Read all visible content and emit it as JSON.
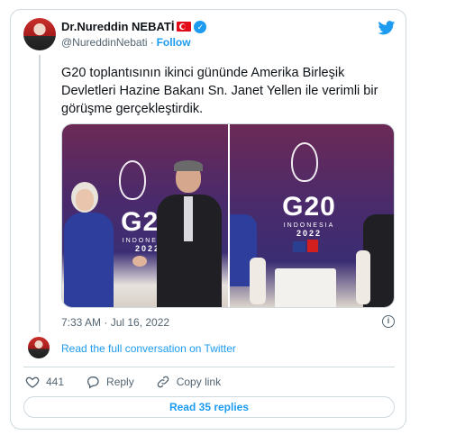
{
  "author": {
    "display_name": "Dr.Nureddin NEBATİ",
    "handle": "@NureddinNebati",
    "separator": "·",
    "follow_label": "Follow",
    "verified_mark": "✓"
  },
  "tweet": {
    "text": "G20 toplantısının ikinci gününde Amerika Birleşik Devletleri Hazine Bakanı Sn. Janet Yellen ile verimli bir görüşme gerçekleştirdik.",
    "timestamp": "7:33 AM · Jul 16, 2022",
    "info_glyph": "i"
  },
  "media": {
    "left_photo": {
      "logo_main": "G20",
      "logo_sub": "INDONESIA",
      "logo_year": "2022"
    },
    "right_photo": {
      "logo_main": "G20",
      "logo_sub": "INDONESIA",
      "logo_year": "2022"
    }
  },
  "conversation": {
    "link_label": "Read the full conversation on Twitter"
  },
  "actions": {
    "like_count": "441",
    "reply_label": "Reply",
    "copy_link_label": "Copy link"
  },
  "replies_button": {
    "label": "Read 35 replies"
  },
  "colors": {
    "accent": "#1d9bf0",
    "muted": "#536471",
    "border": "#cfd9de"
  },
  "icons": [
    "twitter-bird-icon",
    "verified-badge-icon",
    "turkey-flag-icon",
    "info-icon",
    "heart-icon",
    "reply-icon",
    "link-icon"
  ]
}
